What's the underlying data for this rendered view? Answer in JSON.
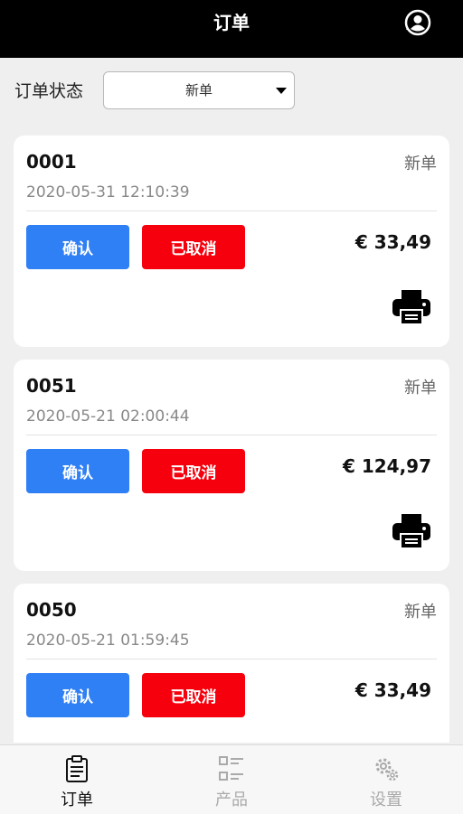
{
  "header": {
    "title": "订单",
    "user_icon": "user-circle-icon"
  },
  "filter": {
    "label": "订单状态",
    "selected": "新单"
  },
  "orders": [
    {
      "id": "0001",
      "status": "新单",
      "time": "2020-05-31 12:10:39",
      "confirm_label": "确认",
      "cancel_label": "已取消",
      "price": "€ 33,49"
    },
    {
      "id": "0051",
      "status": "新单",
      "time": "2020-05-21 02:00:44",
      "confirm_label": "确认",
      "cancel_label": "已取消",
      "price": "€ 124,97"
    },
    {
      "id": "0050",
      "status": "新单",
      "time": "2020-05-21 01:59:45",
      "confirm_label": "确认",
      "cancel_label": "已取消",
      "price": "€ 33,49"
    }
  ],
  "tabs": [
    {
      "label": "订单",
      "icon": "clipboard-icon",
      "active": true
    },
    {
      "label": "产品",
      "icon": "list-icon",
      "active": false
    },
    {
      "label": "设置",
      "icon": "gear-icon",
      "active": false
    }
  ],
  "colors": {
    "confirm": "#2f7ff5",
    "cancel": "#f5000c",
    "header": "#000000"
  }
}
